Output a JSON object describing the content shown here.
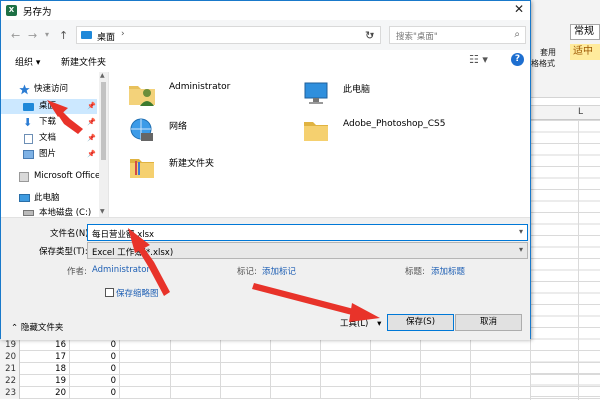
{
  "dialog": {
    "title": "另存为",
    "app_icon_text": "X",
    "address": {
      "current": "桌面",
      "separator": "›"
    },
    "search_placeholder": "搜索\"桌面\"",
    "toolbar": {
      "organize": "组织 ▾",
      "new_folder": "新建文件夹"
    },
    "nav_pane": [
      {
        "label": "快速访问",
        "icon": "star-icon"
      },
      {
        "label": "桌面",
        "icon": "desktop-folder-icon",
        "selected": true,
        "pinned": true
      },
      {
        "label": "下载",
        "icon": "download-icon",
        "pinned": true
      },
      {
        "label": "文档",
        "icon": "document-icon",
        "pinned": true
      },
      {
        "label": "图片",
        "icon": "picture-icon",
        "pinned": true
      },
      {
        "label": "Microsoft Office",
        "icon": "office-icon"
      },
      {
        "label": "此电脑",
        "icon": "computer-icon"
      },
      {
        "label": "本地磁盘 (C:)",
        "icon": "disk-icon"
      }
    ],
    "files": [
      {
        "label": "Administrator",
        "icon": "user-folder-icon"
      },
      {
        "label": "此电脑",
        "icon": "computer-icon"
      },
      {
        "label": "网络",
        "icon": "network-icon"
      },
      {
        "label": "Adobe_Photoshop_CS5",
        "icon": "folder-icon"
      },
      {
        "label": "新建文件夹",
        "icon": "folder-icon"
      }
    ],
    "form": {
      "filename_label": "文件名(N):",
      "filename_value": "每日营业额.xlsx",
      "filetype_label": "保存类型(T):",
      "filetype_value": "Excel 工作簿(*.xlsx)",
      "author_label": "作者:",
      "author_value": "Administrator",
      "tags_label": "标记:",
      "tags_value": "添加标记",
      "title_label": "标题:",
      "title_value": "添加标题",
      "thumbnail_label": "保存缩略图",
      "hide_folders": "隐藏文件夹",
      "tools": "工具(L)",
      "save": "保存(S)",
      "cancel": "取消"
    }
  },
  "excel": {
    "style_normal": "常规",
    "style_medium": "适中",
    "ribbon_label_1": "套用",
    "ribbon_label_2": "格格式",
    "column_header": "L",
    "rows": [
      {
        "row": "19",
        "b": "16",
        "c": "0"
      },
      {
        "row": "20",
        "b": "17",
        "c": "0"
      },
      {
        "row": "21",
        "b": "18",
        "c": "0"
      },
      {
        "row": "22",
        "b": "19",
        "c": "0"
      },
      {
        "row": "23",
        "b": "20",
        "c": "0"
      }
    ]
  },
  "colors": {
    "accent": "#0078d7",
    "selection": "#cce8ff",
    "arrow": "#e8332a"
  }
}
